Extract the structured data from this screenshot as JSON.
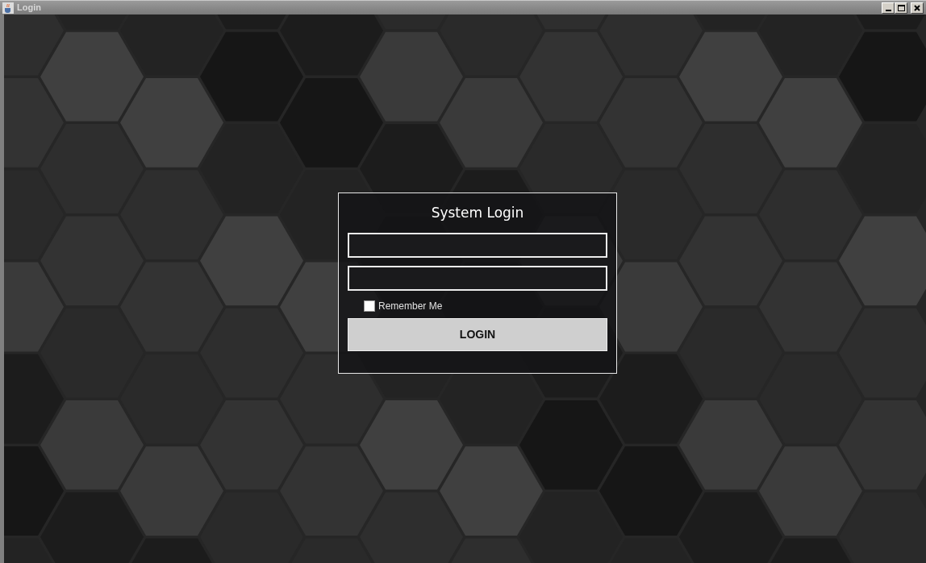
{
  "window": {
    "title": "Login"
  },
  "login": {
    "title": "System Login",
    "remember": {
      "label": "Remember Me",
      "checked": false
    },
    "button": "LOGIN"
  }
}
